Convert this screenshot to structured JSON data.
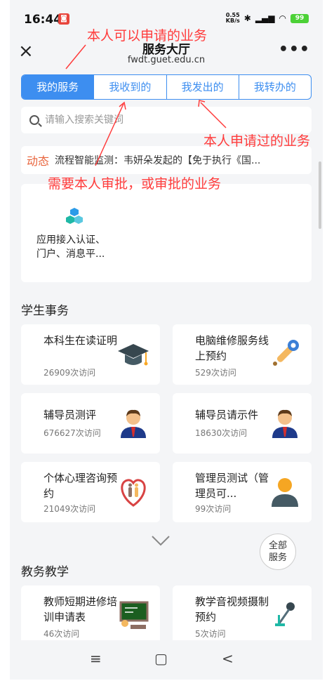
{
  "status_bar": {
    "time": "16:44",
    "speed_value": "0.55",
    "speed_unit": "KB/s",
    "battery": "99"
  },
  "nav": {
    "title": "服务大厅",
    "subtitle": "fwdt.guet.edu.cn",
    "close_icon": "×",
    "more_icon": "•••"
  },
  "tabs": [
    {
      "label": "我的服务",
      "active": true
    },
    {
      "label": "我收到的",
      "active": false
    },
    {
      "label": "我发出的",
      "active": false
    },
    {
      "label": "我转办的",
      "active": false
    }
  ],
  "search": {
    "placeholder": "请输入搜索关键词"
  },
  "news": {
    "tag": "动态",
    "text": "流程智能监测：韦妍朵发起的【免于执行《国..."
  },
  "feature": {
    "label_line1": "应用接入认证、",
    "label_line2": "门户、消息平..."
  },
  "sections": {
    "student_affairs": "学生事务",
    "teaching": "教务教学"
  },
  "student_cards": [
    {
      "title": "本科生在读证明",
      "visits": "26909次访问",
      "icon": "graduation-cap-icon"
    },
    {
      "title": "电脑维修服务线上预约",
      "visits": "529次访问",
      "icon": "wrench-icon"
    },
    {
      "title": "辅导员测评",
      "visits": "676627次访问",
      "icon": "counselor-avatar-icon"
    },
    {
      "title": "辅导员请示件",
      "visits": "18630次访问",
      "icon": "counselor-avatar-icon"
    },
    {
      "title": "个体心理咨询预约",
      "visits": "21049次访问",
      "icon": "heart-icon"
    },
    {
      "title": "管理员测试（管理员可...",
      "visits": "99次访问",
      "icon": "user-icon"
    }
  ],
  "teaching_cards": [
    {
      "title": "教师短期进修培训申请表",
      "visits": "46次访问",
      "icon": "blackboard-icon"
    },
    {
      "title": "教学音视频摄制预约",
      "visits": "5次访问",
      "icon": "microphone-icon"
    }
  ],
  "all_services": {
    "line1": "全部",
    "line2": "服务"
  },
  "system_nav": {
    "menu": "≡",
    "home": "▢",
    "back": "<"
  },
  "annotations": {
    "top": "本人可以申请的业务",
    "right": "本人申请过的业务",
    "middle": "需要本人审批，或审批的业务"
  },
  "colors": {
    "accent": "#3d8ef0",
    "annotation": "#ff3b3b",
    "news_tag": "#e8643c"
  }
}
